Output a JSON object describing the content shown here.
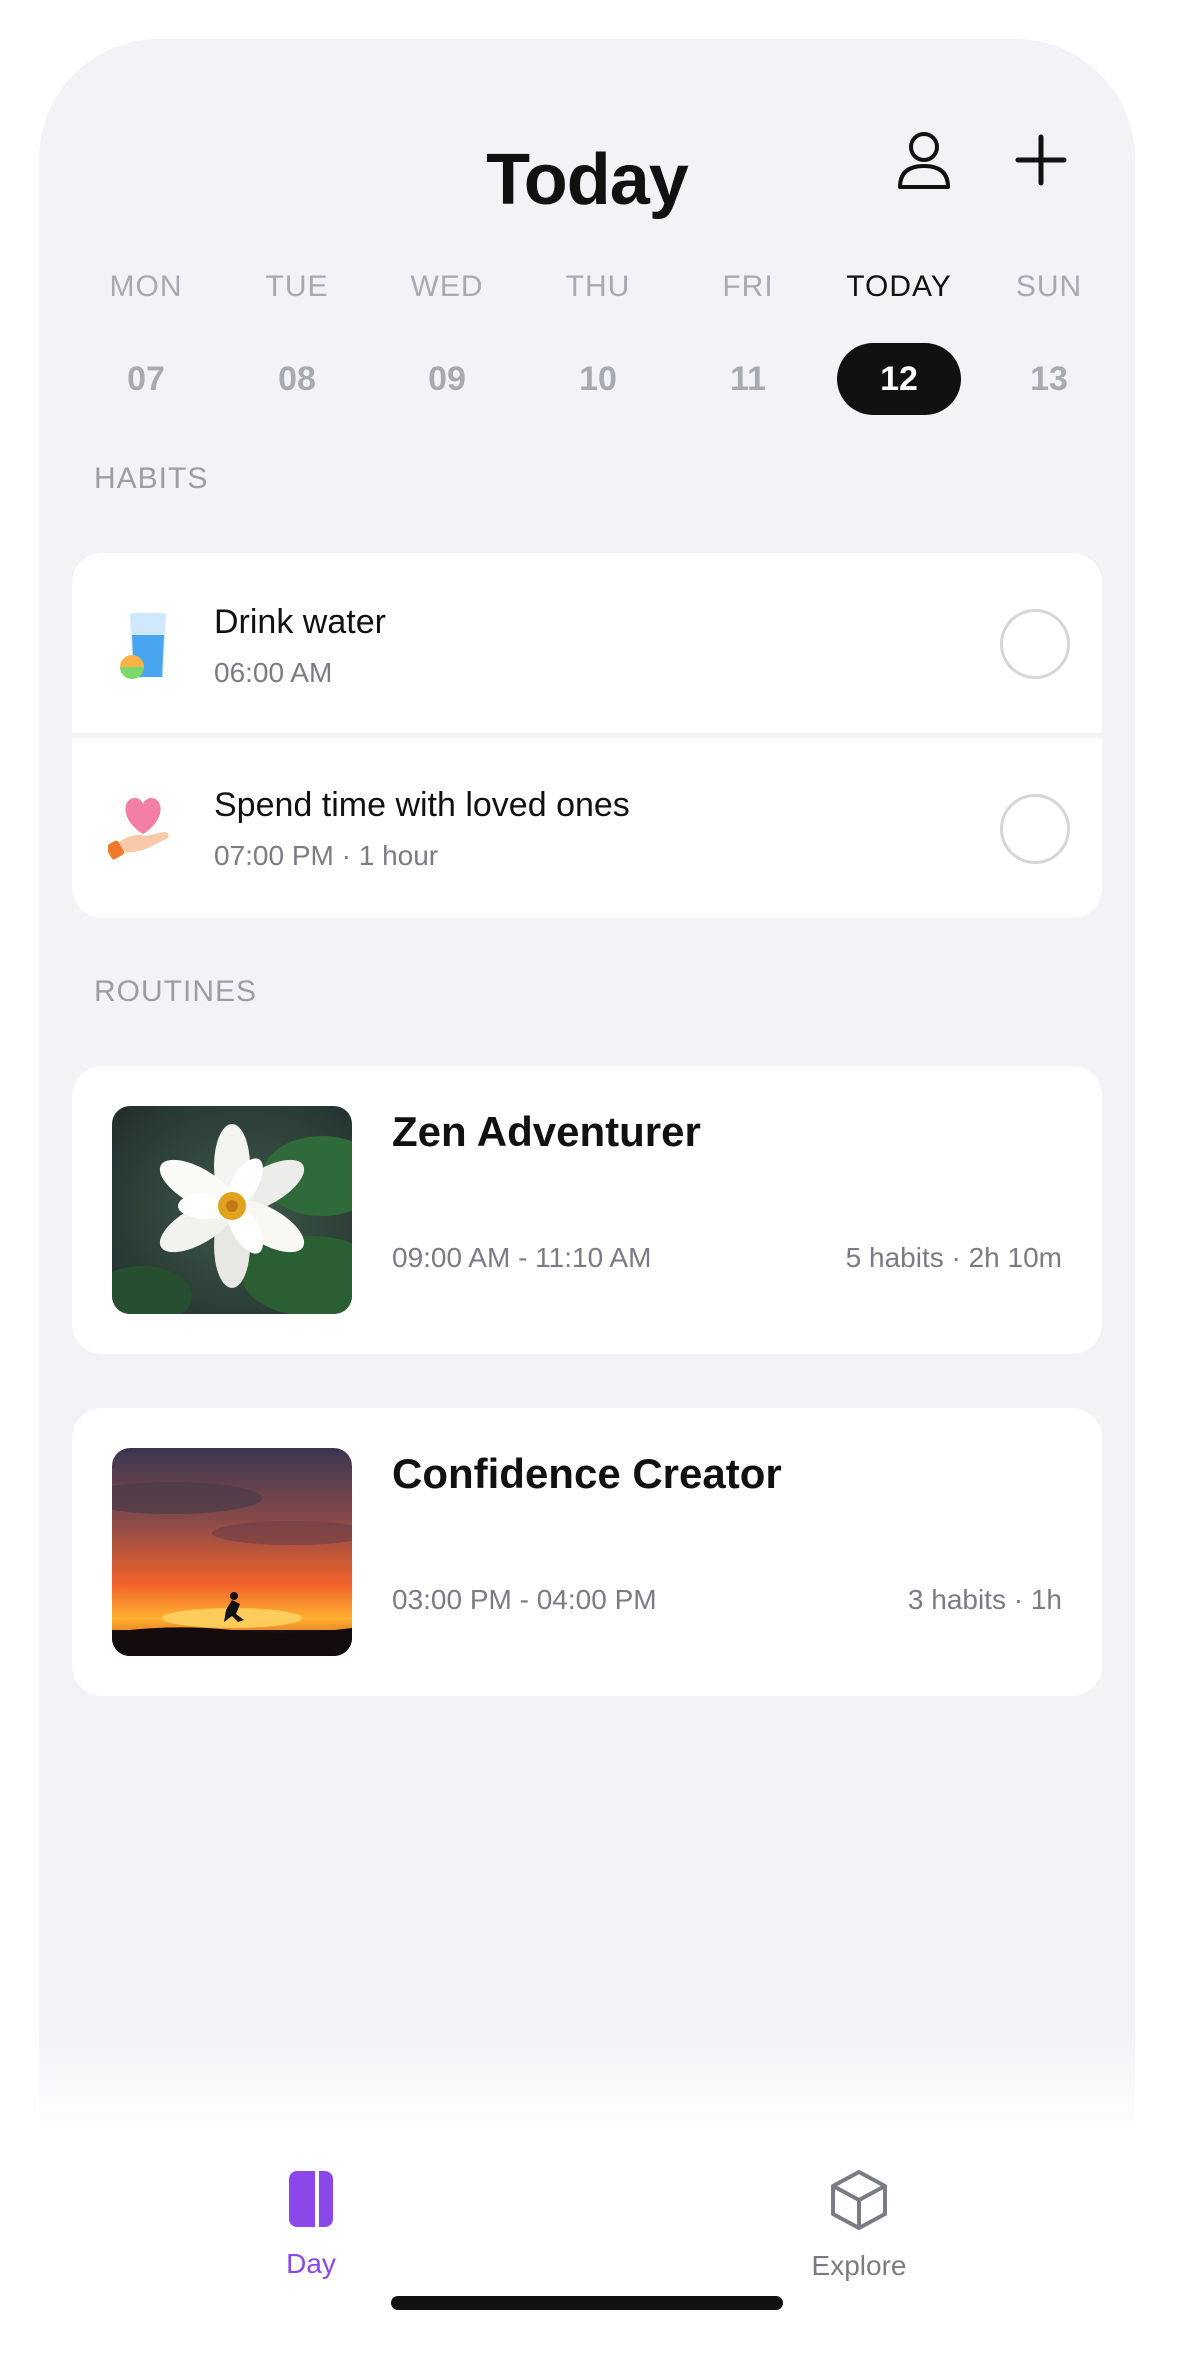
{
  "header": {
    "title": "Today"
  },
  "week": [
    {
      "name": "MON",
      "num": "07"
    },
    {
      "name": "TUE",
      "num": "08"
    },
    {
      "name": "WED",
      "num": "09"
    },
    {
      "name": "THU",
      "num": "10"
    },
    {
      "name": "FRI",
      "num": "11"
    },
    {
      "name": "TODAY",
      "num": "12",
      "selected": true
    },
    {
      "name": "SUN",
      "num": "13"
    }
  ],
  "habits": {
    "label": "HABITS",
    "items": [
      {
        "title": "Drink water",
        "sub": "06:00 AM",
        "icon": "water-glass-icon",
        "done": false
      },
      {
        "title": "Spend time with loved ones",
        "sub": "07:00 PM · 1 hour",
        "icon": "heart-hand-icon",
        "done": false
      }
    ]
  },
  "routines": {
    "label": "ROUTINES",
    "items": [
      {
        "title": "Zen Adventurer",
        "time": "09:00 AM - 11:10 AM",
        "meta": "5 habits · 2h 10m",
        "image": "water-lily-photo"
      },
      {
        "title": "Confidence Creator",
        "time": "03:00 PM - 04:00 PM",
        "meta": "3 habits · 1h",
        "image": "sunset-jump-photo"
      }
    ]
  },
  "tabbar": {
    "items": [
      {
        "label": "Day",
        "icon": "day-book-icon",
        "active": true
      },
      {
        "label": "Explore",
        "icon": "cube-icon",
        "active": false
      }
    ]
  },
  "colors": {
    "accent": "#8b47e8",
    "inactive": "#7b7b86",
    "background": "#f2f2f7"
  }
}
